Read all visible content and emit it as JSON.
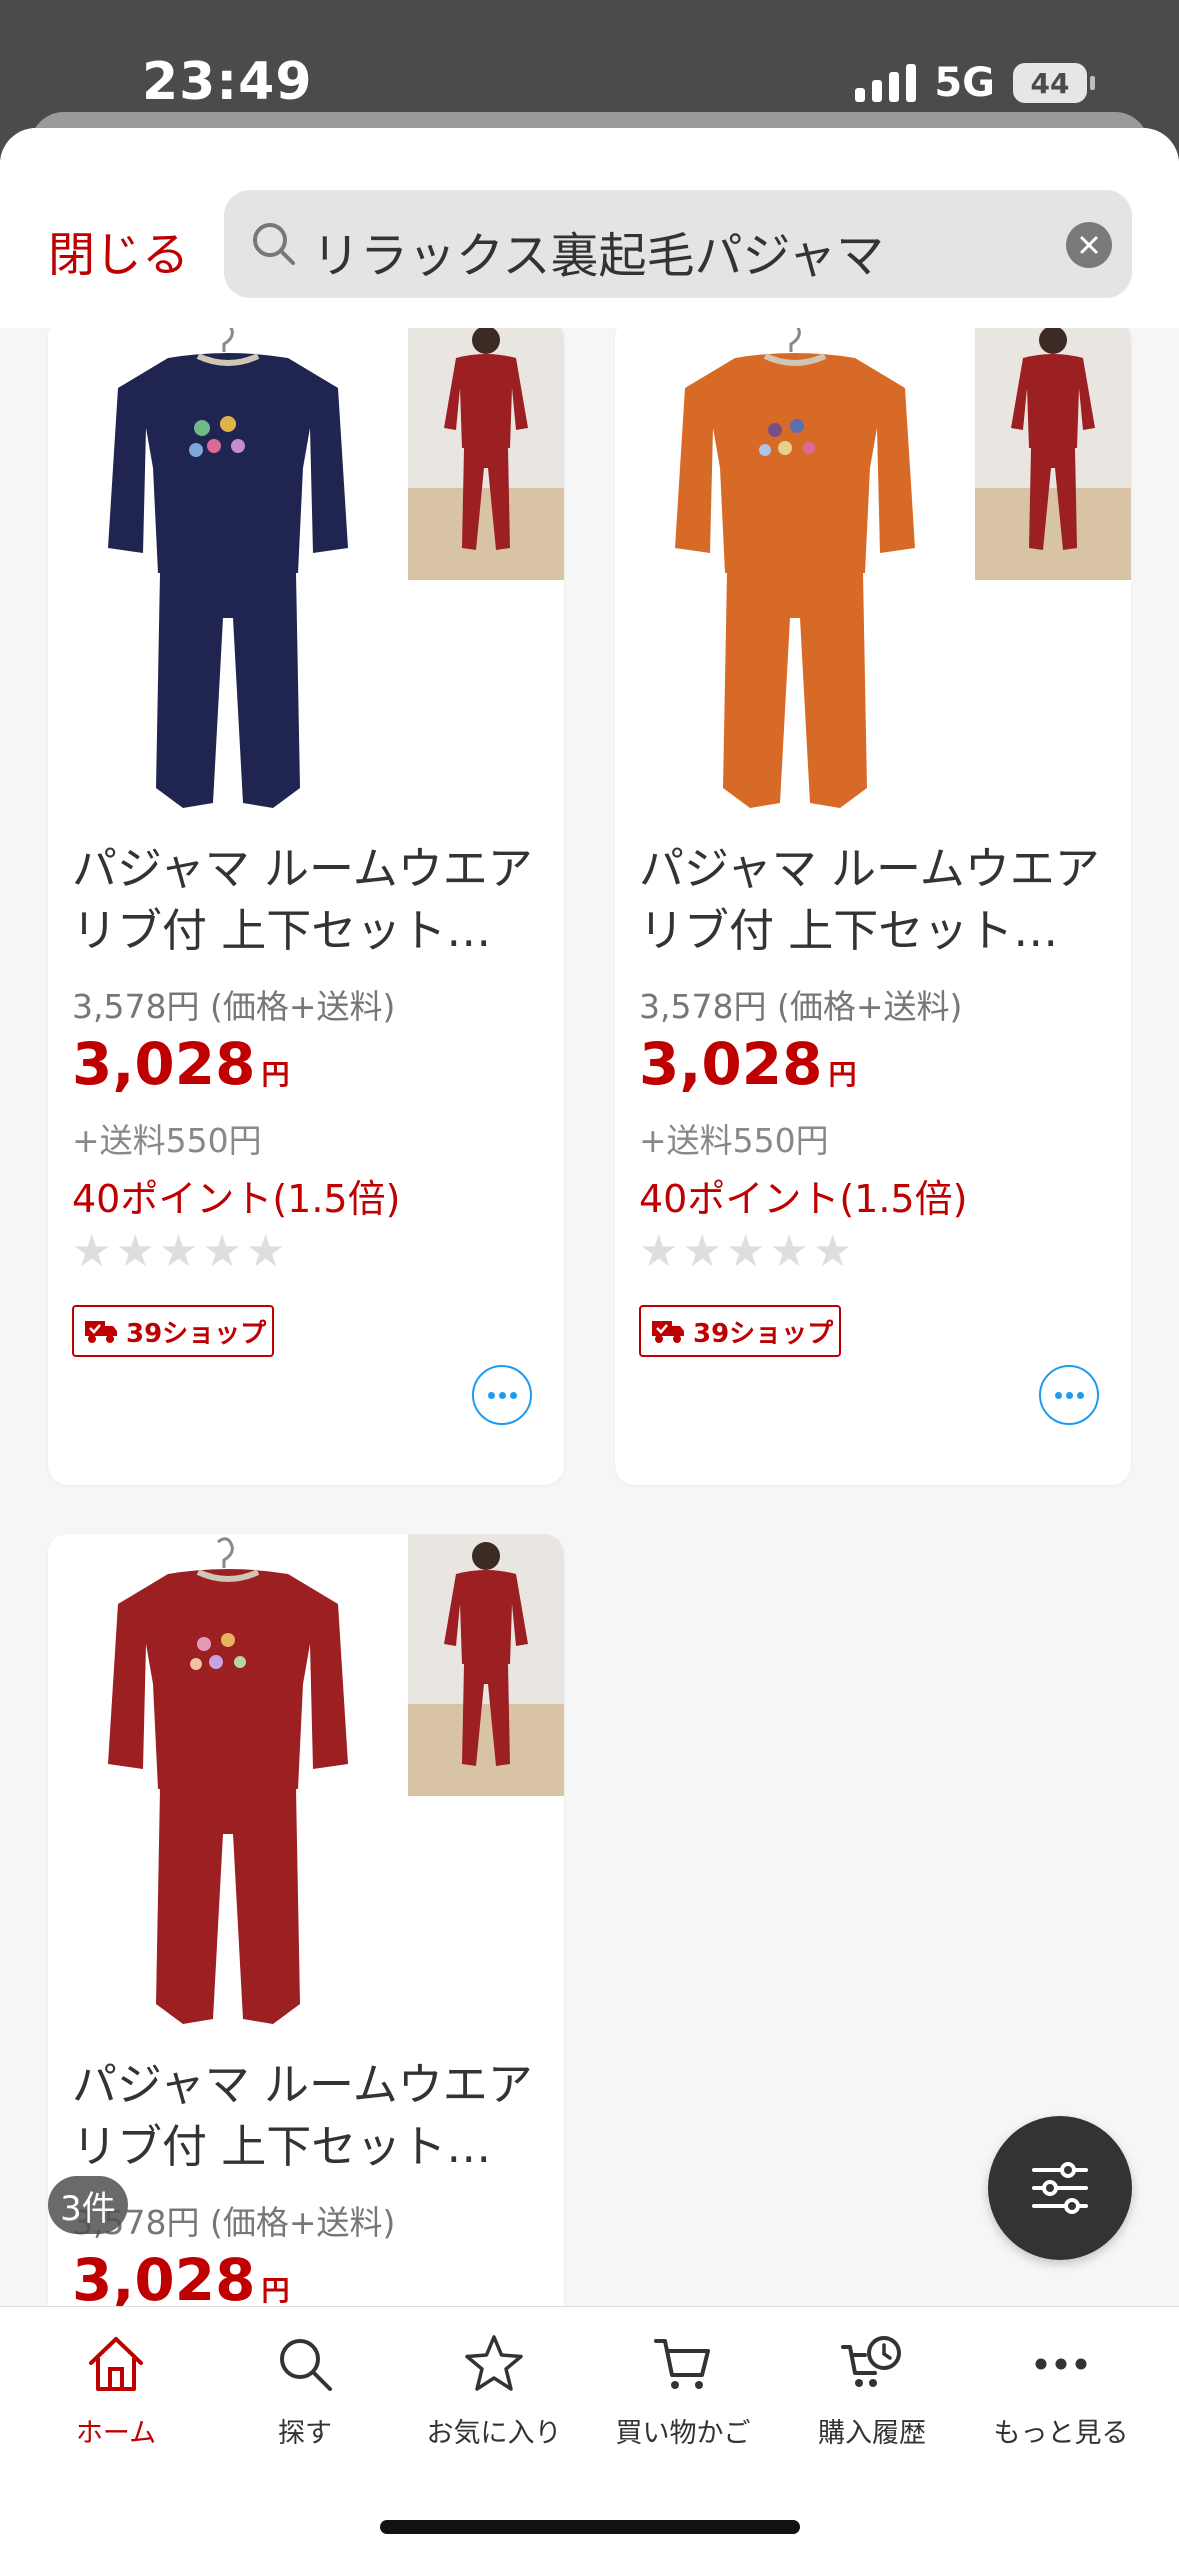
{
  "status_bar": {
    "time": "23:49",
    "network": "5G",
    "battery": "44"
  },
  "header": {
    "close_label": "閉じる",
    "search_query": "リラックス裏起毛パジャマ"
  },
  "products": [
    {
      "title": "パジャマ ルームウエア リブ付 上下セット…",
      "reference_price": "3,578円 (価格+送料)",
      "price": "3,028",
      "currency": "円",
      "shipping": "+送料550円",
      "points": "40ポイント(1.5倍)",
      "rating_stars": 0,
      "badge": "39ショップ",
      "color": "#1f2550"
    },
    {
      "title": "パジャマ ルームウエア リブ付 上下セット…",
      "reference_price": "3,578円 (価格+送料)",
      "price": "3,028",
      "currency": "円",
      "shipping": "+送料550円",
      "points": "40ポイント(1.5倍)",
      "rating_stars": 0,
      "badge": "39ショップ",
      "color": "#d86a28"
    },
    {
      "title": "パジャマ ルームウエア リブ付 上下セット…",
      "reference_price": "3,578円 (価格+送料)",
      "price": "3,028",
      "currency": "円",
      "color": "#9c1f22"
    }
  ],
  "result_count": "3件",
  "tab_bar": {
    "items": [
      {
        "label": "ホーム",
        "icon": "home-icon",
        "active": true
      },
      {
        "label": "探す",
        "icon": "search-icon"
      },
      {
        "label": "お気に入り",
        "icon": "star-icon"
      },
      {
        "label": "買い物かご",
        "icon": "cart-icon"
      },
      {
        "label": "購入履歴",
        "icon": "history-icon"
      },
      {
        "label": "もっと見る",
        "icon": "more-icon"
      }
    ]
  },
  "colors": {
    "accent": "#bf0000",
    "link_blue": "#1d9bf0"
  }
}
